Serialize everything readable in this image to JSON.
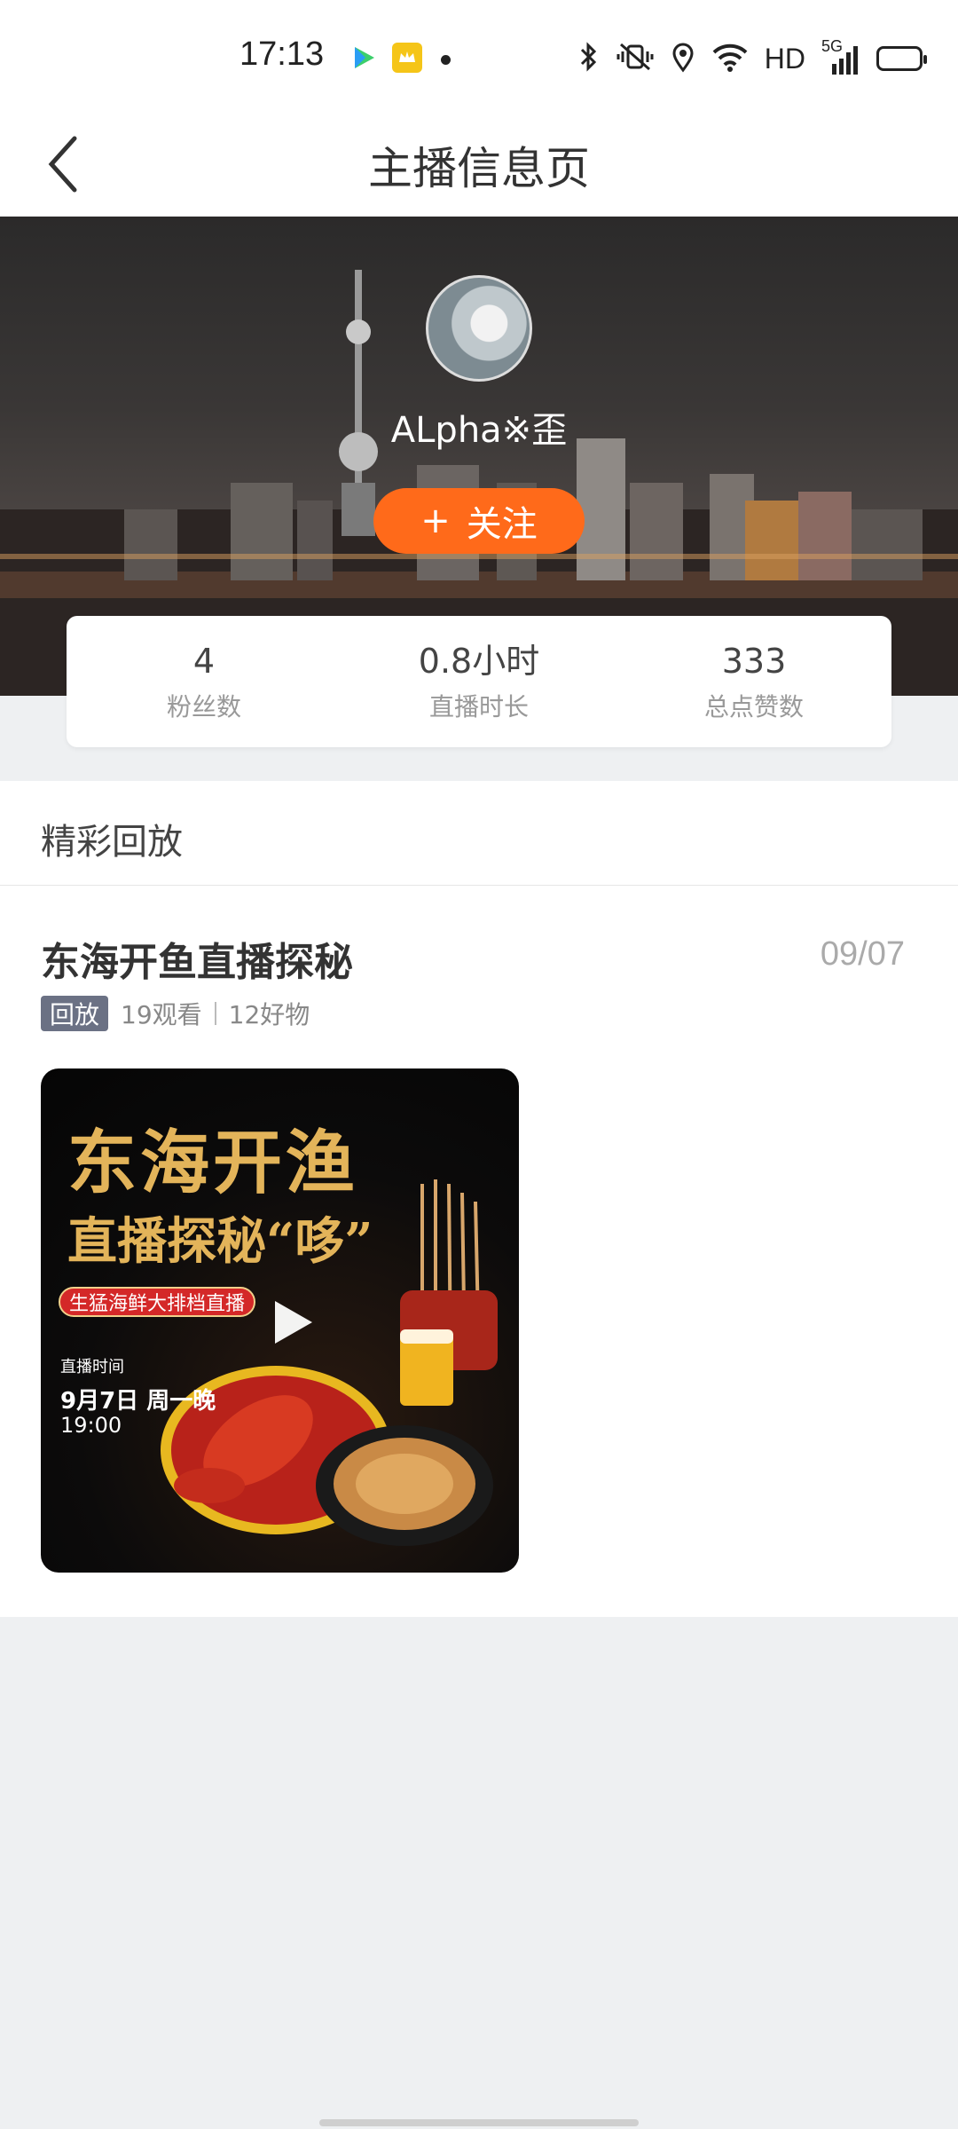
{
  "status_bar": {
    "time": "17:13",
    "hd_label": "HD",
    "network_label": "5G",
    "icons": [
      "video-app-icon",
      "crown-app-icon",
      "bluetooth-icon",
      "vibrate-icon",
      "location-icon",
      "wifi-icon",
      "signal-icon",
      "battery-icon"
    ]
  },
  "nav": {
    "title": "主播信息页",
    "back_icon": "chevron-left-icon"
  },
  "profile": {
    "name": "ALpha※歪",
    "follow_label": "关注",
    "follow_icon": "+"
  },
  "stats": [
    {
      "value": "4",
      "label": "粉丝数"
    },
    {
      "value": "0.8小时",
      "label": "直播时长"
    },
    {
      "value": "333",
      "label": "总点赞数"
    }
  ],
  "replays": {
    "section_title": "精彩回放",
    "items": [
      {
        "title": "东海开鱼直播探秘",
        "date": "09/07",
        "badge": "回放",
        "views": "19观看",
        "goods": "12好物",
        "poster": {
          "line1": "东海开渔",
          "line2": "直播探秘“哆”",
          "banner": "生猛海鲜大排档直播",
          "time_label": "直播时间",
          "date": "9月7日 周一晚",
          "hour": "19:00"
        }
      }
    ]
  },
  "colors": {
    "accent": "#ff6a1a",
    "badge": "#6b7184",
    "page_bg": "#eef0f2"
  }
}
